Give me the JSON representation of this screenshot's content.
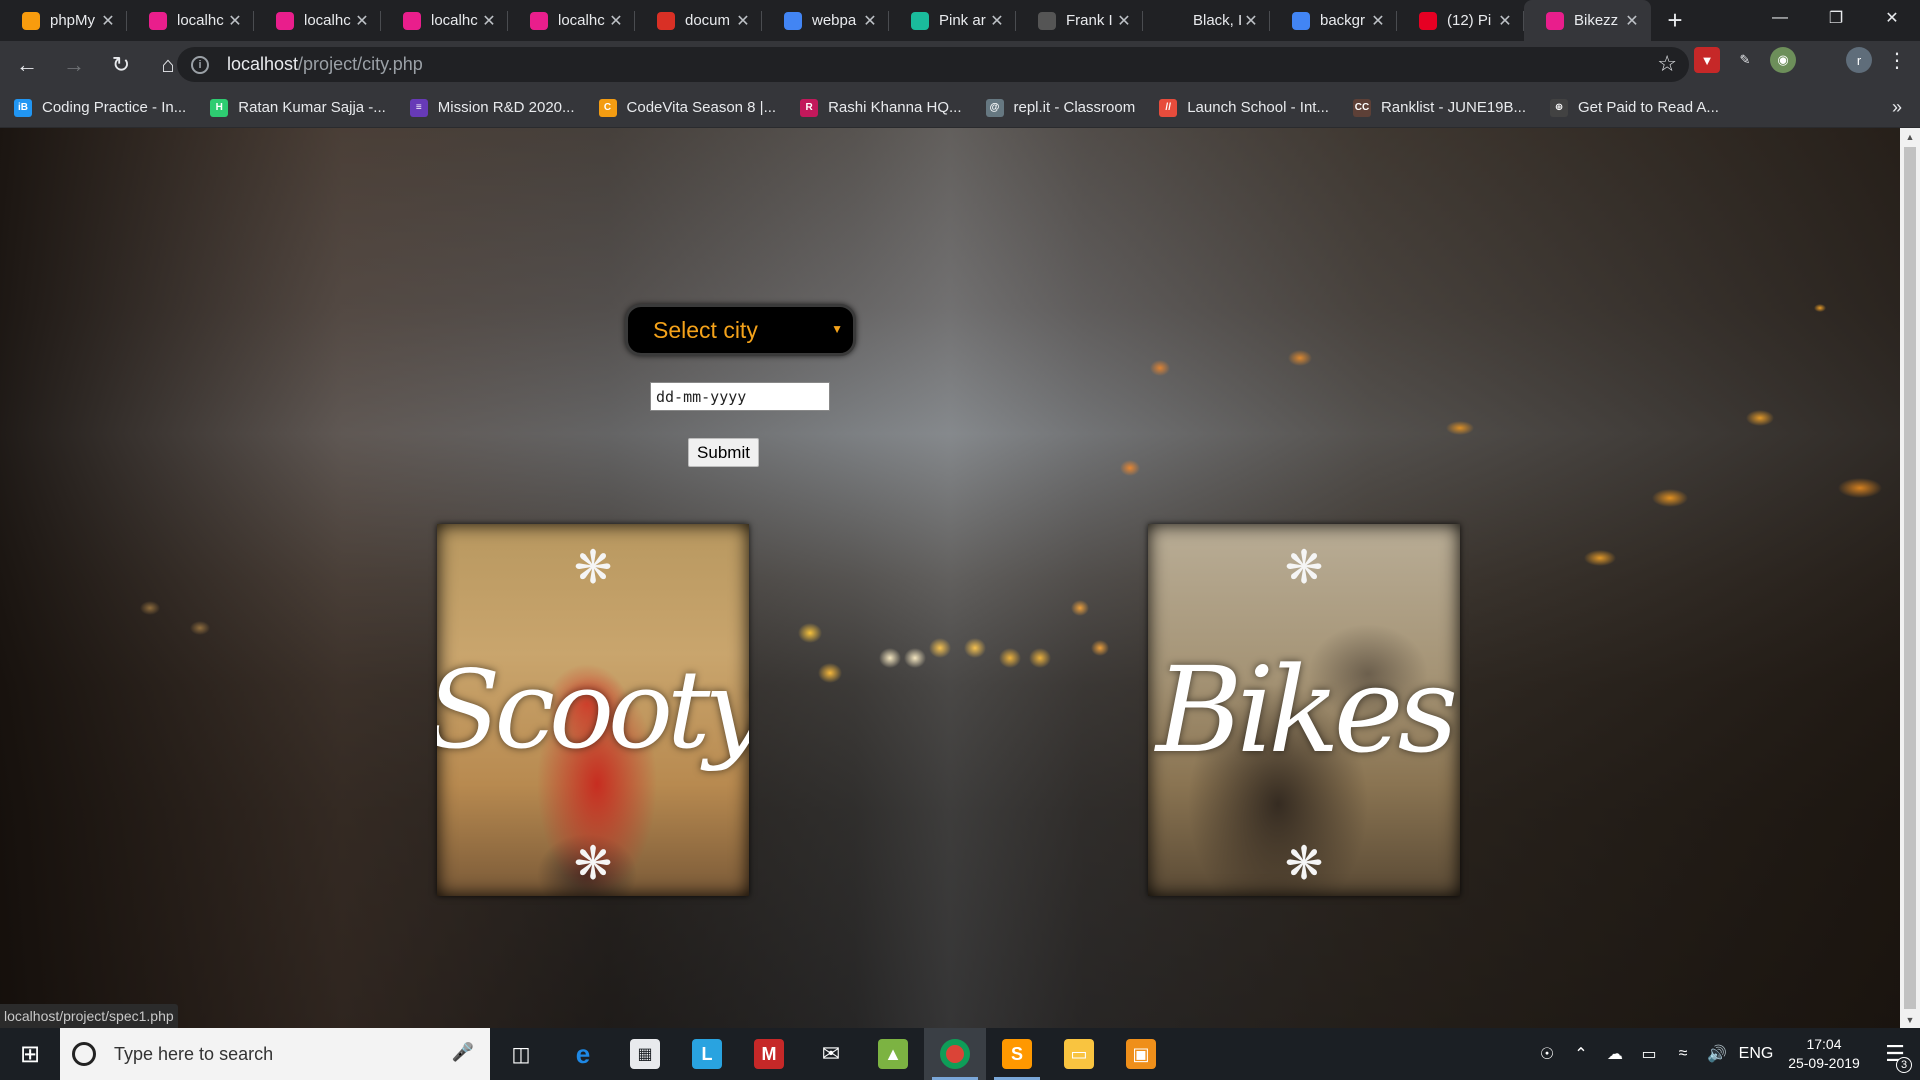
{
  "browser": {
    "tabs": [
      {
        "title": "phpMy",
        "favicon_color": "#f89c0e",
        "icon": "phpmyadmin-icon",
        "active": false
      },
      {
        "title": "localhc",
        "favicon_color": "#e91e8c",
        "icon": "localhost-icon",
        "active": false
      },
      {
        "title": "localhc",
        "favicon_color": "#e91e8c",
        "icon": "localhost-icon",
        "active": false
      },
      {
        "title": "localhc",
        "favicon_color": "#e91e8c",
        "icon": "localhost-icon",
        "active": false
      },
      {
        "title": "localhc",
        "favicon_color": "#e91e8c",
        "icon": "localhost-icon",
        "active": false
      },
      {
        "title": "docum",
        "favicon_color": "#d93025",
        "icon": "gmail-icon",
        "active": false
      },
      {
        "title": "webpa",
        "favicon_color": "#4285f4",
        "icon": "google-icon",
        "active": false
      },
      {
        "title": "Pink ar",
        "favicon_color": "#1abc9c",
        "icon": "doc-icon",
        "active": false
      },
      {
        "title": "Frank I",
        "favicon_color": "#555555",
        "icon": "video-icon",
        "active": false
      },
      {
        "title": "Black, I",
        "favicon_color": "#202124",
        "icon": "blank-icon",
        "active": false
      },
      {
        "title": "backgr",
        "favicon_color": "#4285f4",
        "icon": "google-icon",
        "active": false
      },
      {
        "title": "(12) Pi",
        "favicon_color": "#e60023",
        "icon": "pinterest-icon",
        "active": false
      },
      {
        "title": "Bikezz",
        "favicon_color": "#e91e8c",
        "icon": "localhost-icon",
        "active": true
      }
    ],
    "url_host": "localhost",
    "url_path": "/project/city.php",
    "bookmarks": [
      {
        "label": "Coding Practice - In...",
        "icon_text": "iB",
        "color": "#2196f3"
      },
      {
        "label": "Ratan Kumar Sajja -...",
        "icon_text": "H",
        "color": "#2ecc71"
      },
      {
        "label": "Mission R&D 2020...",
        "icon_text": "≡",
        "color": "#673ab7"
      },
      {
        "label": "CodeVita Season 8 |...",
        "icon_text": "C",
        "color": "#f39c12"
      },
      {
        "label": "Rashi Khanna HQ...",
        "icon_text": "R",
        "color": "#c2185b"
      },
      {
        "label": "repl.it - Classroom",
        "icon_text": "@",
        "color": "#667881"
      },
      {
        "label": "Launch School - Int...",
        "icon_text": "//",
        "color": "#e74c3c"
      },
      {
        "label": "Ranklist - JUNE19B...",
        "icon_text": "CC",
        "color": "#5d4037"
      },
      {
        "label": "Get Paid to Read A...",
        "icon_text": "⊕",
        "color": "#424242"
      }
    ]
  },
  "page": {
    "select_city_label": "Select city",
    "date_placeholder": "dd-mm-yyyy",
    "submit_label": "Submit",
    "card_scooty_title": "Scooty",
    "card_bikes_title": "Bikes",
    "status_url": "localhost/project/spec1.php"
  },
  "taskbar": {
    "search_placeholder": "Type here to search",
    "language": "ENG",
    "time": "17:04",
    "date": "25-09-2019",
    "notification_count": "3"
  }
}
